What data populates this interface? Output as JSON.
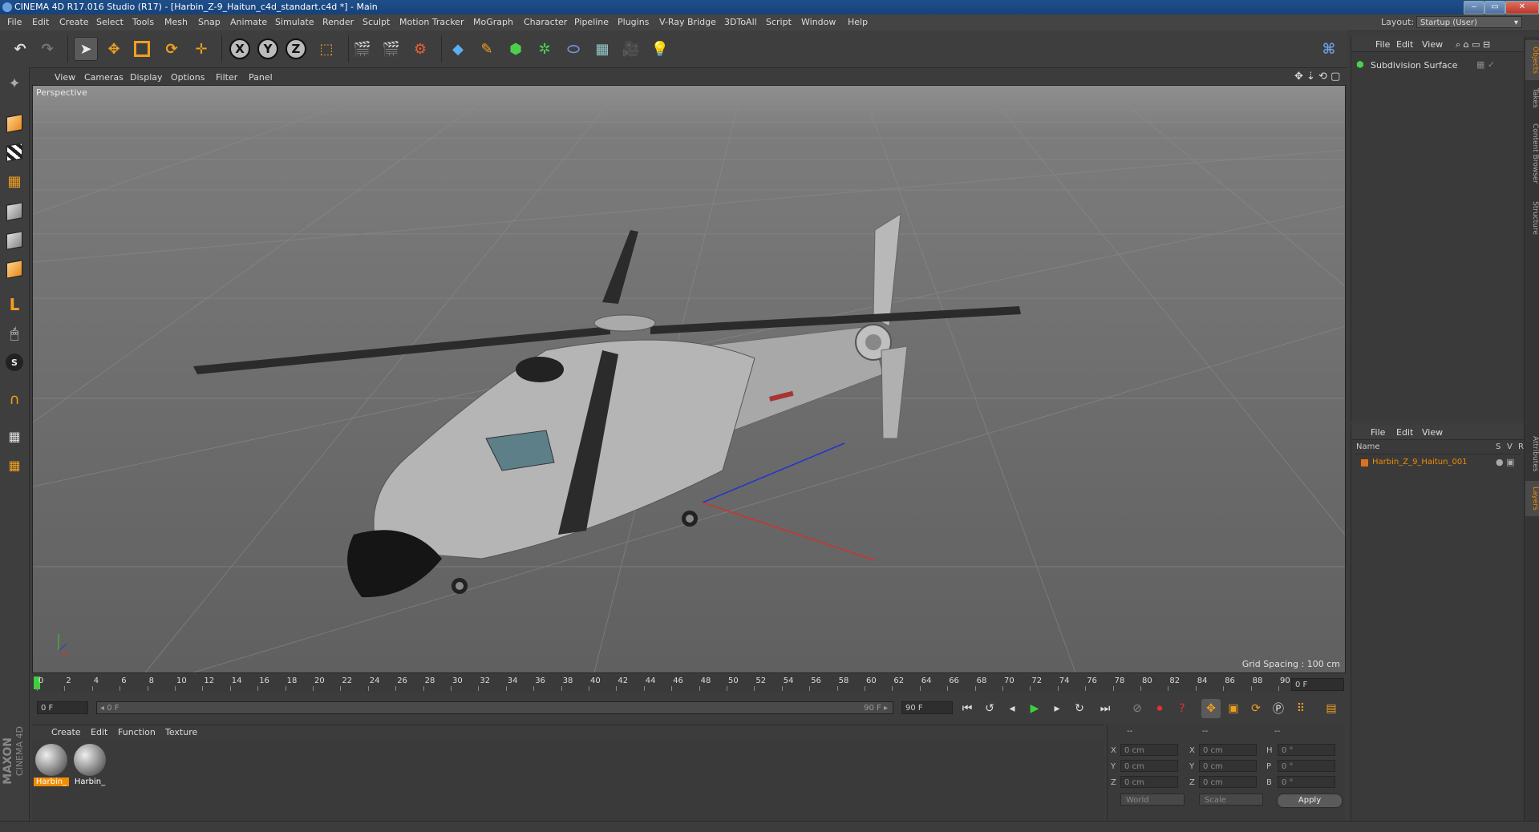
{
  "window": {
    "title": "CINEMA 4D R17.016 Studio (R17) - [Harbin_Z-9_Haitun_c4d_standart.c4d *] - Main",
    "min": "‒",
    "max": "▭",
    "close": "✕"
  },
  "menubar": {
    "items": [
      "File",
      "Edit",
      "Create",
      "Select",
      "Tools",
      "Mesh",
      "Snap",
      "Animate",
      "Simulate",
      "Render",
      "Sculpt",
      "Motion Tracker",
      "MoGraph",
      "Character",
      "Pipeline",
      "Plugins",
      "V-Ray Bridge",
      "3DToAll",
      "Script",
      "Window",
      "Help"
    ],
    "layout_label": "Layout:",
    "layout_value": "Startup (User)"
  },
  "viewport": {
    "menu": [
      "View",
      "Cameras",
      "Display",
      "Options",
      "Filter",
      "Panel"
    ],
    "label": "Perspective",
    "grid_spacing": "Grid Spacing : 100 cm"
  },
  "timeline": {
    "ticks": [
      "0",
      "2",
      "4",
      "6",
      "8",
      "10",
      "12",
      "14",
      "16",
      "18",
      "20",
      "22",
      "24",
      "26",
      "28",
      "30",
      "32",
      "34",
      "36",
      "38",
      "40",
      "42",
      "44",
      "46",
      "48",
      "50",
      "52",
      "54",
      "56",
      "58",
      "60",
      "62",
      "64",
      "66",
      "68",
      "70",
      "72",
      "74",
      "76",
      "78",
      "80",
      "82",
      "84",
      "86",
      "88",
      "90"
    ],
    "current_frame": "0 F"
  },
  "playback": {
    "start_field": "0 F",
    "range_start": "◂ 0 F",
    "range_end": "90 F ▸",
    "end_field": "90 F"
  },
  "material_manager": {
    "menu": [
      "Create",
      "Edit",
      "Function",
      "Texture"
    ],
    "materials": [
      {
        "label": "Harbin_",
        "selected": true
      },
      {
        "label": "Harbin_",
        "selected": false
      }
    ]
  },
  "coordinates": {
    "header": [
      "--",
      "--",
      "--"
    ],
    "rows": [
      {
        "a": "X",
        "av": "0 cm",
        "b": "X",
        "bv": "0 cm",
        "c": "H",
        "cv": "0 °"
      },
      {
        "a": "Y",
        "av": "0 cm",
        "b": "Y",
        "bv": "0 cm",
        "c": "P",
        "cv": "0 °"
      },
      {
        "a": "Z",
        "av": "0 cm",
        "b": "Z",
        "bv": "0 cm",
        "c": "B",
        "cv": "0 °"
      }
    ],
    "mode1": "World",
    "mode2": "Scale",
    "apply": "Apply"
  },
  "objects_panel": {
    "menu": [
      "File",
      "Edit",
      "View"
    ],
    "objects": [
      {
        "name": "Subdivision Surface"
      }
    ]
  },
  "layers_panel": {
    "menu": [
      "File",
      "Edit",
      "View"
    ],
    "header": {
      "name": "Name",
      "s": "S",
      "v": "V",
      "r": "R"
    },
    "items": [
      {
        "name": "Harbin_Z_9_Haitun_001"
      }
    ]
  },
  "right_tabs": [
    "Objects",
    "Takes",
    "Content Browser",
    "Structure",
    "Attributes",
    "Layers"
  ],
  "branding": {
    "maxon": "MAXON",
    "product": "CINEMA 4D"
  },
  "colors": {
    "accent": "#f08c00",
    "title_bar": "#1f4f8a",
    "play_green": "#3fd03f"
  }
}
